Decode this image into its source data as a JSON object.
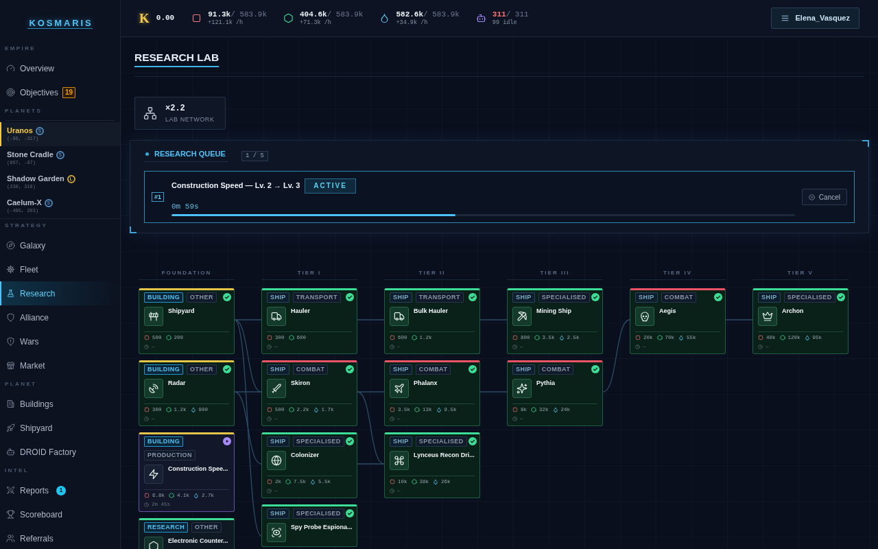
{
  "sidebar": {
    "logo": "KOSMARIS",
    "sections": [
      {
        "label": "EMPIRE",
        "kind": "nav",
        "items": [
          {
            "label": "Overview",
            "selected": false
          },
          {
            "label": "Objectives",
            "selected": false,
            "badge": {
              "text": "19",
              "kind": "outline"
            }
          }
        ]
      },
      {
        "label": "PLANETS",
        "kind": "planets",
        "items": [
          {
            "name": "Uranos",
            "size": {
              "label": "S",
              "color": "#4f86b8"
            },
            "coords": "(-96, -317)",
            "selected": true
          },
          {
            "name": "Stone Cradle",
            "size": {
              "label": "S",
              "color": "#4f86b8"
            },
            "coords": "(867, -87)",
            "selected": false
          },
          {
            "name": "Shadow Garden",
            "size": {
              "label": "L",
              "color": "#c9a23a"
            },
            "coords": "(230, 318)",
            "selected": false
          },
          {
            "name": "Caelum-X",
            "size": {
              "label": "S",
              "color": "#4f86b8"
            },
            "coords": "(-495, 203)",
            "selected": false
          }
        ]
      },
      {
        "label": "STRATEGY",
        "kind": "nav",
        "items": [
          {
            "label": "Galaxy",
            "selected": false
          },
          {
            "label": "Fleet",
            "selected": false
          },
          {
            "label": "Research",
            "selected": true
          },
          {
            "label": "Alliance",
            "selected": false
          },
          {
            "label": "Wars",
            "selected": false
          },
          {
            "label": "Market",
            "selected": false
          }
        ]
      },
      {
        "label": "PLANET",
        "kind": "nav",
        "items": [
          {
            "label": "Buildings",
            "selected": false
          },
          {
            "label": "Shipyard",
            "selected": false
          },
          {
            "label": "DROID Factory",
            "selected": false
          }
        ]
      },
      {
        "label": "INTEL",
        "kind": "nav",
        "items": [
          {
            "label": "Reports",
            "selected": false,
            "badge": {
              "text": "1",
              "kind": "filled"
            }
          },
          {
            "label": "Scoreboard",
            "selected": false
          },
          {
            "label": "Referrals",
            "selected": false
          }
        ]
      }
    ]
  },
  "top_bar": {
    "credits": {
      "symbol": "K",
      "amount": "0.00"
    },
    "resources": [
      {
        "kind": "square",
        "amount": "91.3k",
        "capacity": "/ 583.9k",
        "detail": "+121.1k /h",
        "full": false
      },
      {
        "kind": "hexagon",
        "amount": "404.6k",
        "capacity": "/ 583.9k",
        "detail": "+71.3k /h",
        "full": false
      },
      {
        "kind": "drop",
        "amount": "582.6k",
        "capacity": "/ 583.9k",
        "detail": "+34.9k /h",
        "full": false
      },
      {
        "kind": "droid",
        "amount": "311",
        "capacity": "/ 311",
        "detail": "99 idle",
        "full": true
      }
    ],
    "user_menu": {
      "label": "Elena_Vasquez"
    }
  },
  "page_title": "RESEARCH LAB",
  "lab_network": {
    "value": "×2.2",
    "label": "LAB NETWORK"
  },
  "research_queue": {
    "title": "RESEARCH QUEUE",
    "count": "1 / 5",
    "items": [
      {
        "position": "#1",
        "title": "Construction Speed — Lv. 2 → Lv. 3",
        "status": "ACTIVE",
        "remaining": "0m 59s",
        "level": 0.455,
        "action": "Cancel"
      }
    ]
  },
  "tech_tree": {
    "columns": [
      {
        "title": "FOUNDATION",
        "cards": [
          {
            "kind": "building",
            "tags": [
              "BUILDING",
              "OTHER"
            ],
            "name": "Shipyard",
            "color": "#e5c547",
            "completed": true,
            "in_progress": false,
            "costs": [
              {
                "kind": "square",
                "amount": "500"
              },
              {
                "kind": "hexagon",
                "amount": "200"
              }
            ],
            "time": "—"
          },
          {
            "kind": "building",
            "tags": [
              "BUILDING",
              "OTHER"
            ],
            "name": "Radar",
            "color": "#e5c547",
            "completed": true,
            "in_progress": false,
            "costs": [
              {
                "kind": "square",
                "amount": "300"
              },
              {
                "kind": "hexagon",
                "amount": "1.2k"
              },
              {
                "kind": "drop",
                "amount": "900"
              }
            ],
            "time": "—"
          },
          {
            "kind": "building",
            "tags": [
              "BUILDING",
              "PRODUCTION"
            ],
            "name": "Construction Spee...",
            "color": "#e5c547",
            "completed": false,
            "in_progress": true,
            "costs": [
              {
                "kind": "square",
                "amount": "6.8k"
              },
              {
                "kind": "hexagon",
                "amount": "4.1k"
              },
              {
                "kind": "drop",
                "amount": "2.7k"
              }
            ],
            "time": "2m 45s"
          },
          {
            "kind": "research",
            "tags": [
              "RESEARCH",
              "OTHER"
            ],
            "name": "Electronic Counter...",
            "color": "#3ddc97",
            "completed": false,
            "in_progress": false
          }
        ]
      },
      {
        "title": "TIER I",
        "cards": [
          {
            "kind": "ship",
            "tags": [
              "SHIP",
              "TRANSPORT"
            ],
            "name": "Hauler",
            "color": "#3ddc97",
            "completed": true,
            "in_progress": false,
            "costs": [
              {
                "kind": "square",
                "amount": "300"
              },
              {
                "kind": "hexagon",
                "amount": "600"
              }
            ],
            "time": "—"
          },
          {
            "kind": "ship",
            "tags": [
              "SHIP",
              "COMBAT"
            ],
            "name": "Skiron",
            "color": "#ef5466",
            "completed": true,
            "in_progress": false,
            "costs": [
              {
                "kind": "square",
                "amount": "500"
              },
              {
                "kind": "hexagon",
                "amount": "2.2k"
              },
              {
                "kind": "drop",
                "amount": "1.7k"
              }
            ],
            "time": "—"
          },
          {
            "kind": "ship",
            "tags": [
              "SHIP",
              "SPECIALISED"
            ],
            "name": "Colonizer",
            "color": "#3ddc97",
            "completed": true,
            "in_progress": false,
            "costs": [
              {
                "kind": "square",
                "amount": "2k"
              },
              {
                "kind": "hexagon",
                "amount": "7.5k"
              },
              {
                "kind": "drop",
                "amount": "5.5k"
              }
            ],
            "time": "—"
          },
          {
            "kind": "ship",
            "tags": [
              "SHIP",
              "SPECIALISED"
            ],
            "name": "Spy Probe Espiona...",
            "color": "#3ddc97",
            "completed": true,
            "in_progress": false
          }
        ]
      },
      {
        "title": "TIER II",
        "cards": [
          {
            "kind": "ship",
            "tags": [
              "SHIP",
              "TRANSPORT"
            ],
            "name": "Bulk Hauler",
            "color": "#3ddc97",
            "completed": true,
            "in_progress": false,
            "costs": [
              {
                "kind": "square",
                "amount": "600"
              },
              {
                "kind": "hexagon",
                "amount": "1.2k"
              }
            ],
            "time": "—"
          },
          {
            "kind": "ship",
            "tags": [
              "SHIP",
              "COMBAT"
            ],
            "name": "Phalanx",
            "color": "#ef5466",
            "completed": true,
            "in_progress": false,
            "costs": [
              {
                "kind": "square",
                "amount": "3.5k"
              },
              {
                "kind": "hexagon",
                "amount": "13k"
              },
              {
                "kind": "drop",
                "amount": "9.5k"
              }
            ],
            "time": "—"
          },
          {
            "kind": "ship",
            "tags": [
              "SHIP",
              "SPECIALISED"
            ],
            "name": "Lynceus Recon Dri...",
            "color": "#3ddc97",
            "completed": true,
            "in_progress": false,
            "costs": [
              {
                "kind": "square",
                "amount": "10k"
              },
              {
                "kind": "hexagon",
                "amount": "38k"
              },
              {
                "kind": "drop",
                "amount": "26k"
              }
            ],
            "time": "—"
          }
        ]
      },
      {
        "title": "TIER III",
        "cards": [
          {
            "kind": "ship",
            "tags": [
              "SHIP",
              "SPECIALISED"
            ],
            "name": "Mining Ship",
            "color": "#3ddc97",
            "completed": true,
            "in_progress": false,
            "costs": [
              {
                "kind": "square",
                "amount": "800"
              },
              {
                "kind": "hexagon",
                "amount": "3.5k"
              },
              {
                "kind": "drop",
                "amount": "2.5k"
              }
            ],
            "time": "—"
          },
          {
            "kind": "ship",
            "tags": [
              "SHIP",
              "COMBAT"
            ],
            "name": "Pythia",
            "color": "#ef5466",
            "completed": true,
            "in_progress": false,
            "costs": [
              {
                "kind": "square",
                "amount": "8k"
              },
              {
                "kind": "hexagon",
                "amount": "32k"
              },
              {
                "kind": "drop",
                "amount": "24k"
              }
            ],
            "time": "—"
          }
        ]
      },
      {
        "title": "TIER IV",
        "cards": [
          {
            "kind": "ship",
            "tags": [
              "SHIP",
              "COMBAT"
            ],
            "name": "Aegis",
            "color": "#ef5466",
            "completed": true,
            "in_progress": false,
            "costs": [
              {
                "kind": "square",
                "amount": "20k"
              },
              {
                "kind": "hexagon",
                "amount": "70k"
              },
              {
                "kind": "drop",
                "amount": "55k"
              }
            ],
            "time": "—"
          }
        ]
      },
      {
        "title": "TIER V",
        "cards": [
          {
            "kind": "ship",
            "tags": [
              "SHIP",
              "SPECIALISED"
            ],
            "name": "Archon",
            "color": "#3ddc97",
            "completed": true,
            "in_progress": false,
            "costs": [
              {
                "kind": "square",
                "amount": "40k"
              },
              {
                "kind": "hexagon",
                "amount": "120k"
              },
              {
                "kind": "drop",
                "amount": "95k"
              }
            ],
            "time": "—"
          }
        ]
      }
    ]
  }
}
